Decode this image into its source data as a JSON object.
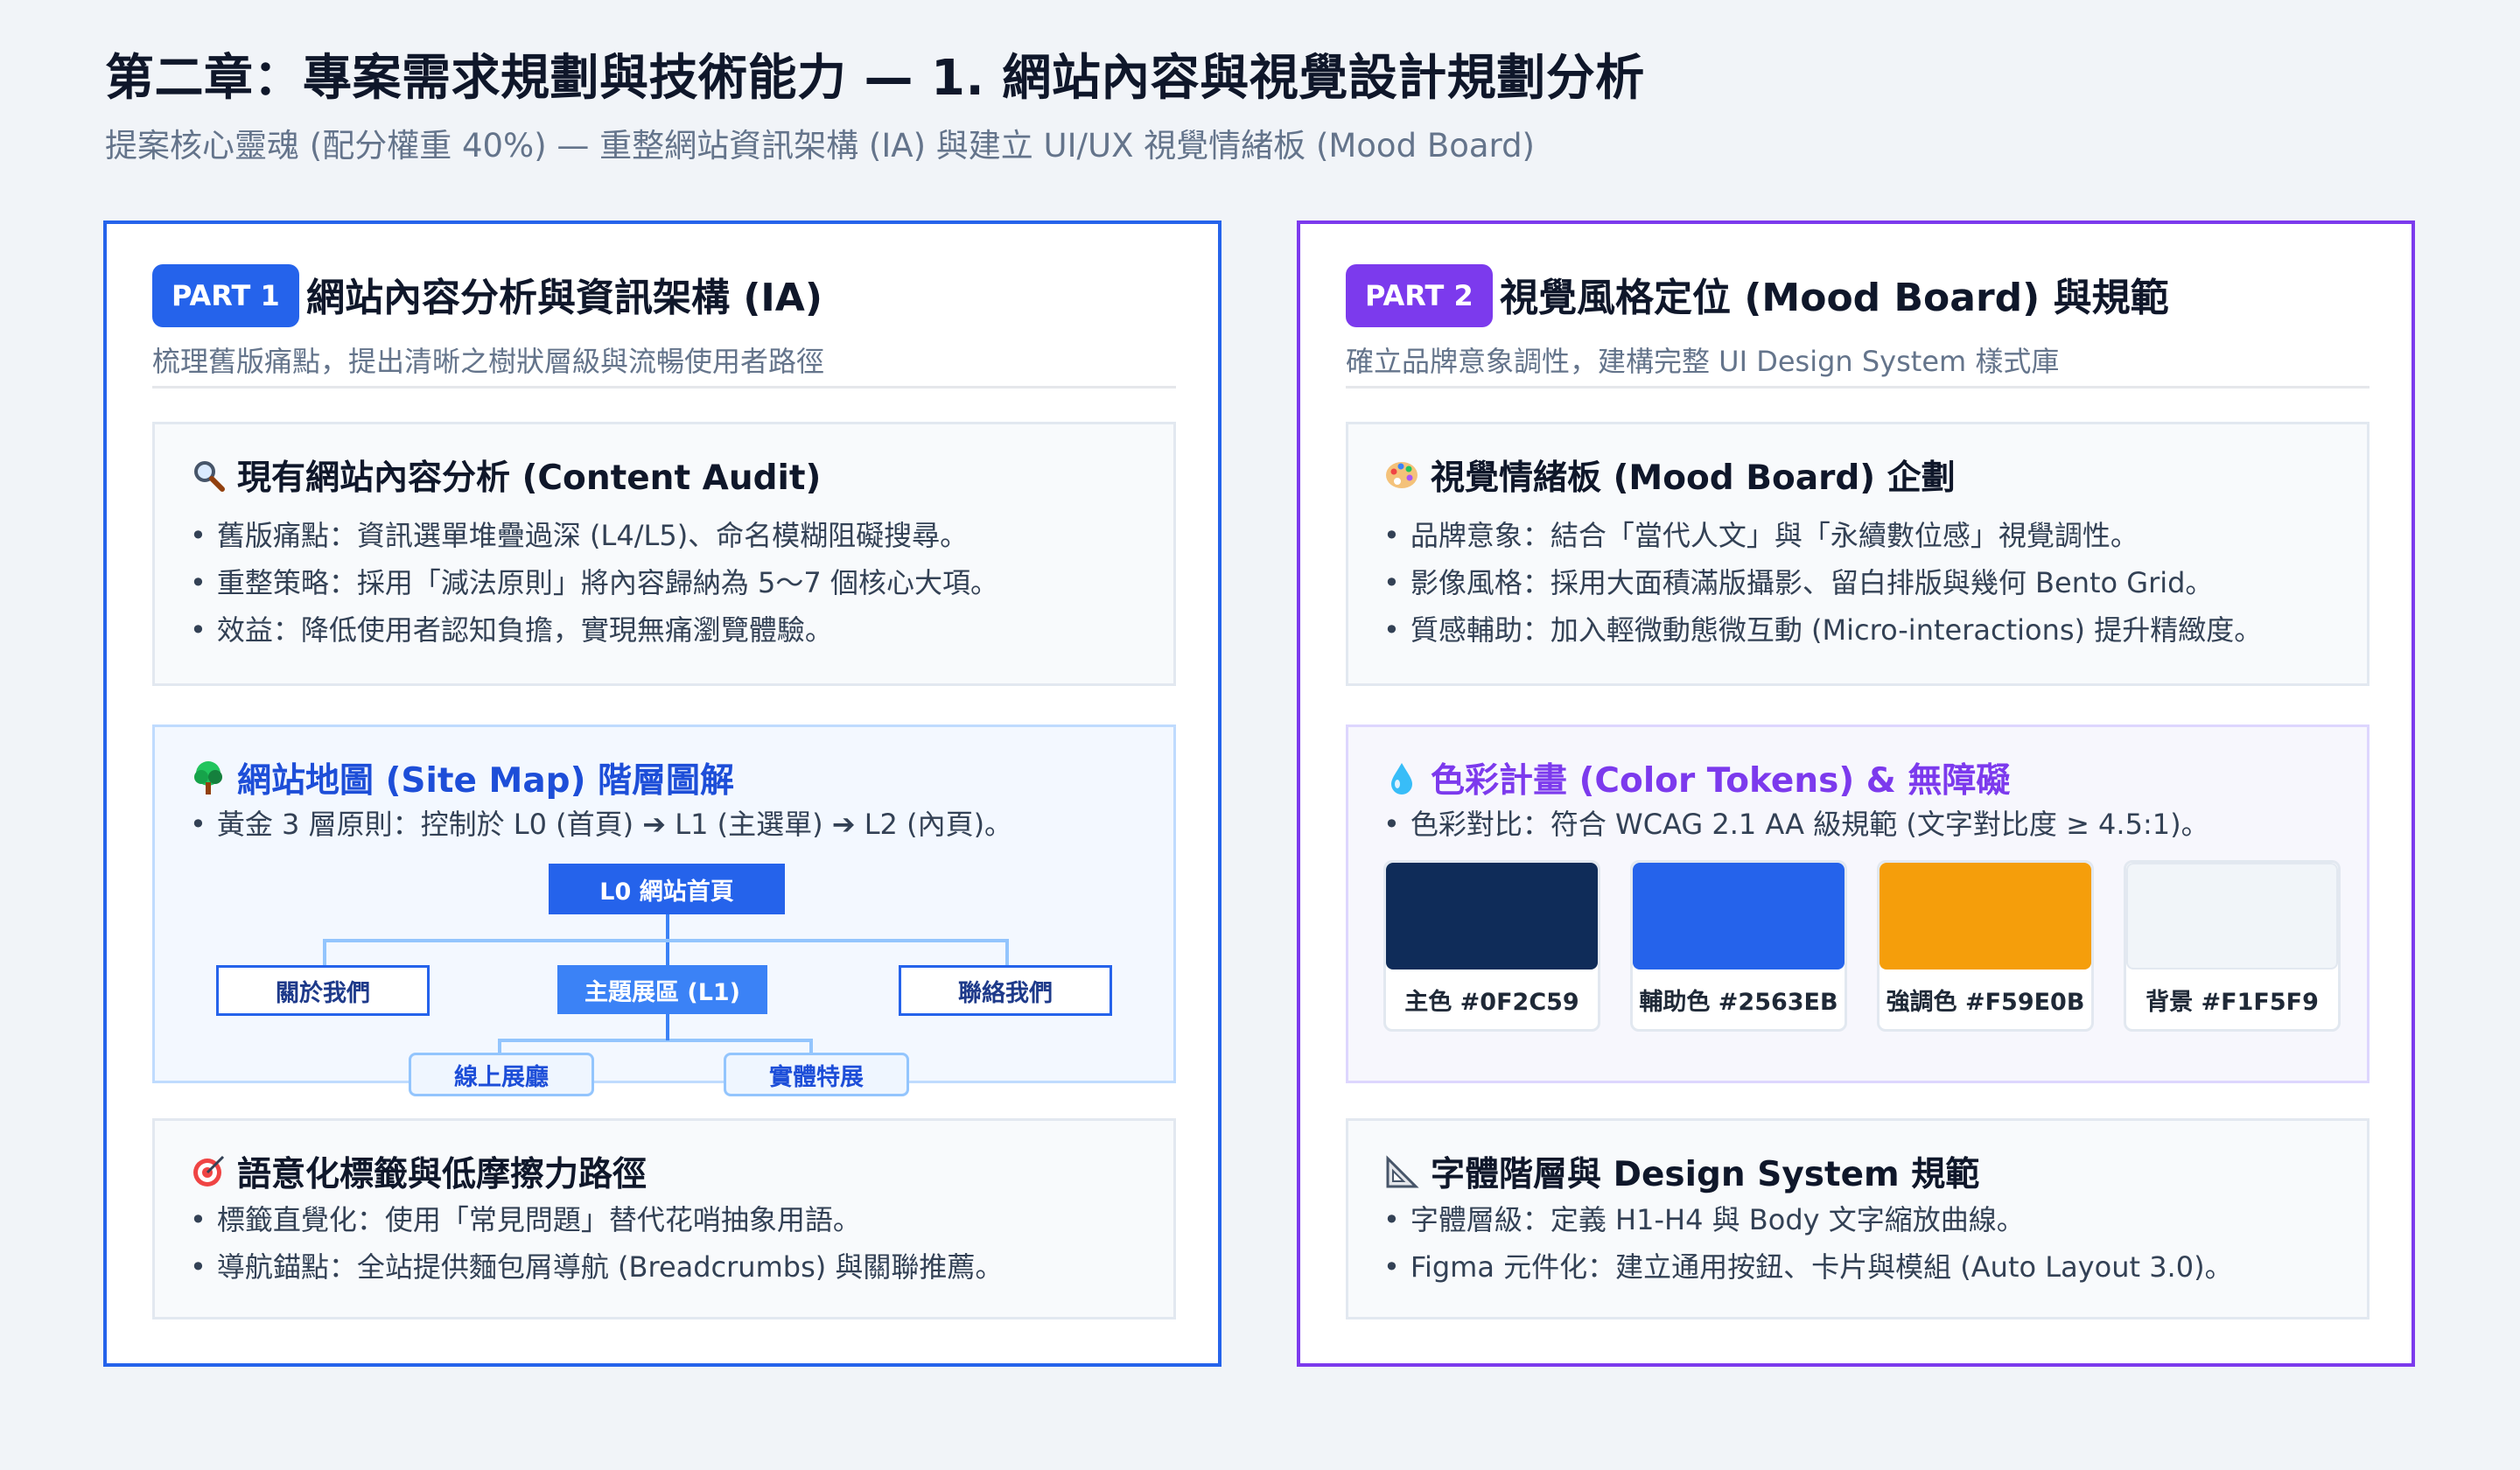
{
  "header": {
    "title": "第二章：專案需求規劃與技術能力 — 1. 網站內容與視覺設計規劃分析",
    "subtitle": "提案核心靈魂 (配分權重 40%) — 重整網站資訊架構 (IA) 與建立 UI/UX 視覺情緒板 (Mood Board)"
  },
  "part1": {
    "badge": "PART 1",
    "title": "網站內容分析與資訊架構 (IA)",
    "desc": "梳理舊版痛點，提出清晰之樹狀層級與流暢使用者路徑",
    "audit": {
      "icon": "magnifier-icon",
      "title": "現有網站內容分析 (Content Audit)",
      "bullets": [
        "舊版痛點：資訊選單堆疊過深 (L4/L5)、命名模糊阻礙搜尋。",
        "重整策略：採用「減法原則」將內容歸納為 5～7 個核心大項。",
        "效益：降低使用者認知負擔，實現無痛瀏覽體驗。"
      ]
    },
    "sitemap": {
      "icon": "tree-icon",
      "title": "網站地圖 (Site Map) 階層圖解",
      "bullet": "黃金 3 層原則：控制於 L0 (首頁) ➔ L1 (主選單) ➔ L2 (內頁)。",
      "root": "L0 網站首頁",
      "l1_left": "關於我們",
      "l1_main": "主題展區 (L1)",
      "l1_right": "聯絡我們",
      "l2_left": "線上展廳",
      "l2_right": "實體特展"
    },
    "semantic": {
      "icon": "target-icon",
      "title": "語意化標籤與低摩擦力路徑",
      "bullets": [
        "標籤直覺化：使用「常見問題」替代花哨抽象用語。",
        "導航錨點：全站提供麵包屑導航 (Breadcrumbs) 與關聯推薦。"
      ]
    }
  },
  "part2": {
    "badge": "PART 2",
    "title": "視覺風格定位 (Mood Board) 與規範",
    "desc": "確立品牌意象調性，建構完整 UI Design System 樣式庫",
    "moodboard": {
      "icon": "palette-icon",
      "title": "視覺情緒板 (Mood Board) 企劃",
      "bullets": [
        "品牌意象：結合「當代人文」與「永續數位感」視覺調性。",
        "影像風格：採用大面積滿版攝影、留白排版與幾何 Bento Grid。",
        "質感輔助：加入輕微動態微互動 (Micro-interactions) 提升精緻度。"
      ]
    },
    "colors": {
      "icon": "droplet-icon",
      "title": "色彩計畫 (Color Tokens) & 無障礙",
      "bullet": "色彩對比：符合 WCAG 2.1 AA 級規範 (文字對比度 ≥ 4.5:1)。",
      "swatches": [
        {
          "label": "主色 #0F2C59",
          "color": "#0F2C59"
        },
        {
          "label": "輔助色 #2563EB",
          "color": "#2563EB"
        },
        {
          "label": "強調色 #F59E0B",
          "color": "#F59E0B"
        },
        {
          "label": "背景 #F1F5F9",
          "color": "#F1F5F9"
        }
      ]
    },
    "typography": {
      "icon": "triangle-ruler-icon",
      "title": "字體階層與 Design System 規範",
      "bullets": [
        "字體層級：定義 H1-H4 與 Body 文字縮放曲線。",
        "Figma 元件化：建立通用按鈕、卡片與模組 (Auto Layout 3.0)。"
      ]
    }
  },
  "colors": {
    "part1_accent": "#2563EB",
    "part2_accent": "#7C3AED"
  }
}
